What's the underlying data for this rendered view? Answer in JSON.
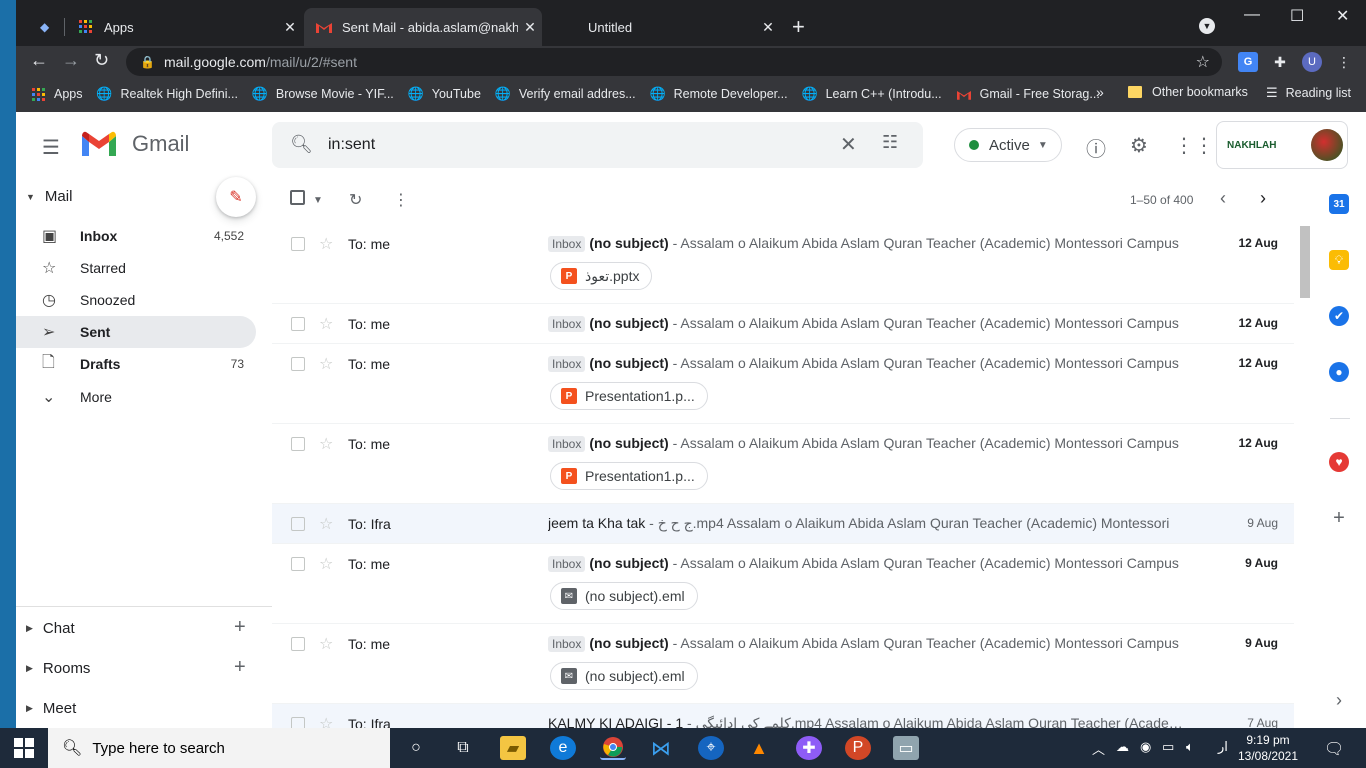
{
  "browser": {
    "tabs": [
      {
        "title": "Apps",
        "icon": "apps-grid-icon"
      },
      {
        "title": "Sent Mail - abida.aslam@nakhlah",
        "icon": "gmail-icon"
      },
      {
        "title": "Untitled",
        "icon": ""
      }
    ],
    "url_host": "mail.google.com",
    "url_path": "/mail/u/2/#sent",
    "bookmarks": [
      "Apps",
      "Realtek High Defini...",
      "Browse Movie - YIF...",
      "YouTube",
      "Verify email addres...",
      "Remote Developer...",
      "Learn C++ (Introdu...",
      "Gmail - Free Storag..."
    ],
    "other_bookmarks": "Other bookmarks",
    "reading_list": "Reading list",
    "profile_initial": "U"
  },
  "gmail": {
    "brand": "Gmail",
    "search_value": "in:sent",
    "status": "Active",
    "account_logo": "NAKHLAH",
    "sidebar": {
      "mail_title": "Mail",
      "items": [
        {
          "label": "Inbox",
          "count": "4,552"
        },
        {
          "label": "Starred",
          "count": ""
        },
        {
          "label": "Snoozed",
          "count": ""
        },
        {
          "label": "Sent",
          "count": ""
        },
        {
          "label": "Drafts",
          "count": "73"
        },
        {
          "label": "More",
          "count": ""
        }
      ],
      "chat": "Chat",
      "rooms": "Rooms",
      "meet": "Meet"
    },
    "pager": "1–50 of 400",
    "label_inbox": "Inbox",
    "emails": [
      {
        "to": "To: me",
        "label": true,
        "subject": "(no subject)",
        "snippet": " - Assalam o Alaikum Abida Aslam Quran Teacher (Academic) Montessori Campus",
        "date": "12 Aug",
        "attachment": "تعوذ.pptx",
        "att_type": "pptx",
        "read": false
      },
      {
        "to": "To: me",
        "label": true,
        "subject": "(no subject)",
        "snippet": " - Assalam o Alaikum Abida Aslam Quran Teacher (Academic) Montessori Campus",
        "date": "12 Aug",
        "attachment": "",
        "att_type": "",
        "read": false
      },
      {
        "to": "To: me",
        "label": true,
        "subject": "(no subject)",
        "snippet": " - Assalam o Alaikum Abida Aslam Quran Teacher (Academic) Montessori Campus",
        "date": "12 Aug",
        "attachment": "Presentation1.p...",
        "att_type": "pptx",
        "read": false
      },
      {
        "to": "To: me",
        "label": true,
        "subject": "(no subject)",
        "snippet": " - Assalam o Alaikum Abida Aslam Quran Teacher (Academic) Montessori Campus",
        "date": "12 Aug",
        "attachment": "Presentation1.p...",
        "att_type": "pptx",
        "read": false
      },
      {
        "to": "To: Ifra",
        "label": false,
        "subject": "jeem ta Kha tak",
        "snippet": " - ج ح خ.mp4 Assalam o Alaikum Abida Aslam Quran Teacher (Academic) Montessori",
        "date": "9 Aug",
        "attachment": "",
        "att_type": "",
        "read": true
      },
      {
        "to": "To: me",
        "label": true,
        "subject": "(no subject)",
        "snippet": " - Assalam o Alaikum Abida Aslam Quran Teacher (Academic) Montessori Campus",
        "date": "9 Aug",
        "attachment": "(no subject).eml",
        "att_type": "eml",
        "read": false
      },
      {
        "to": "To: me",
        "label": true,
        "subject": "(no subject)",
        "snippet": " - Assalam o Alaikum Abida Aslam Quran Teacher (Academic) Montessori Campus",
        "date": "9 Aug",
        "attachment": "(no subject).eml",
        "att_type": "eml",
        "read": false
      },
      {
        "to": "To: Ifra",
        "label": false,
        "subject": "KALMY KI ADAIGI - 1",
        "snippet": " - کلمے کی ادائیگی.mp4 Assalam o Alaikum Abida Aslam Quran Teacher (Academic",
        "date": "7 Aug",
        "attachment": "",
        "att_type": "",
        "read": true
      }
    ]
  },
  "taskbar": {
    "search_placeholder": "Type here to search",
    "time": "9:19 pm",
    "date": "13/08/2021",
    "lang": "ار"
  },
  "colors": {
    "accent_red": "#d93025",
    "status_green": "#1e8e3e",
    "selected_nav": "#e8eaed",
    "chrome_dark": "#35363a"
  }
}
